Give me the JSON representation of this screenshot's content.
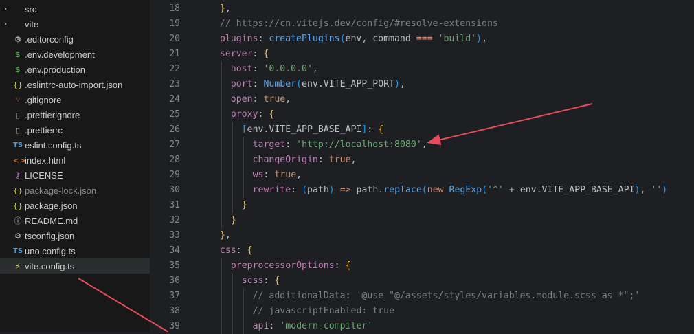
{
  "explorer": {
    "items": [
      {
        "label": "src",
        "icon": "chevron-right",
        "type": "folder"
      },
      {
        "label": "vite",
        "icon": "chevron-right",
        "type": "folder"
      },
      {
        "label": ".editorconfig",
        "icon": "gear-icon"
      },
      {
        "label": ".env.development",
        "icon": "dollar-icon"
      },
      {
        "label": ".env.production",
        "icon": "dollar-icon"
      },
      {
        "label": ".eslintrc-auto-import.json",
        "icon": "json-braces-icon"
      },
      {
        "label": ".gitignore",
        "icon": "git-icon"
      },
      {
        "label": ".prettierignore",
        "icon": "file-icon"
      },
      {
        "label": ".prettierrc",
        "icon": "file-icon"
      },
      {
        "label": "eslint.config.ts",
        "icon": "ts-icon"
      },
      {
        "label": "index.html",
        "icon": "html-icon"
      },
      {
        "label": "LICENSE",
        "icon": "key-icon"
      },
      {
        "label": "package-lock.json",
        "icon": "json-braces-icon",
        "muted": true
      },
      {
        "label": "package.json",
        "icon": "json-braces-icon"
      },
      {
        "label": "README.md",
        "icon": "info-icon"
      },
      {
        "label": "tsconfig.json",
        "icon": "gear-icon"
      },
      {
        "label": "uno.config.ts",
        "icon": "ts-icon"
      },
      {
        "label": "vite.config.ts",
        "icon": "vite-bolt-icon",
        "active": true
      }
    ]
  },
  "editor": {
    "line_numbers": [
      "18",
      "19",
      "20",
      "21",
      "22",
      "23",
      "24",
      "25",
      "26",
      "27",
      "28",
      "29",
      "30",
      "31",
      "32",
      "33",
      "34",
      "35",
      "36",
      "37",
      "38",
      "39"
    ],
    "lines": [
      "},",
      "// https://cn.vitejs.dev/config/#resolve-extensions",
      "plugins: createPlugins(env, command === 'build'),",
      "server: {",
      "host: '0.0.0.0',",
      "port: Number(env.VITE_APP_PORT),",
      "open: true,",
      "proxy: {",
      "[env.VITE_APP_BASE_API]: {",
      "target: 'http://localhost:8080',",
      "changeOrigin: true,",
      "ws: true,",
      "rewrite: (path) => path.replace(new RegExp('^' + env.VITE_APP_BASE_API), '')",
      "}",
      "}",
      "},",
      "css: {",
      "preprocessorOptions: {",
      "scss: {",
      "// additionalData: '@use \"@/assets/styles/variables.module.scss as *\";'",
      "// javascriptEnabled: true",
      "api: 'modern-compiler'"
    ]
  },
  "colors": {
    "arrow": "#e84b5a",
    "background": "#1e1f22",
    "sidebar": "#181818"
  }
}
